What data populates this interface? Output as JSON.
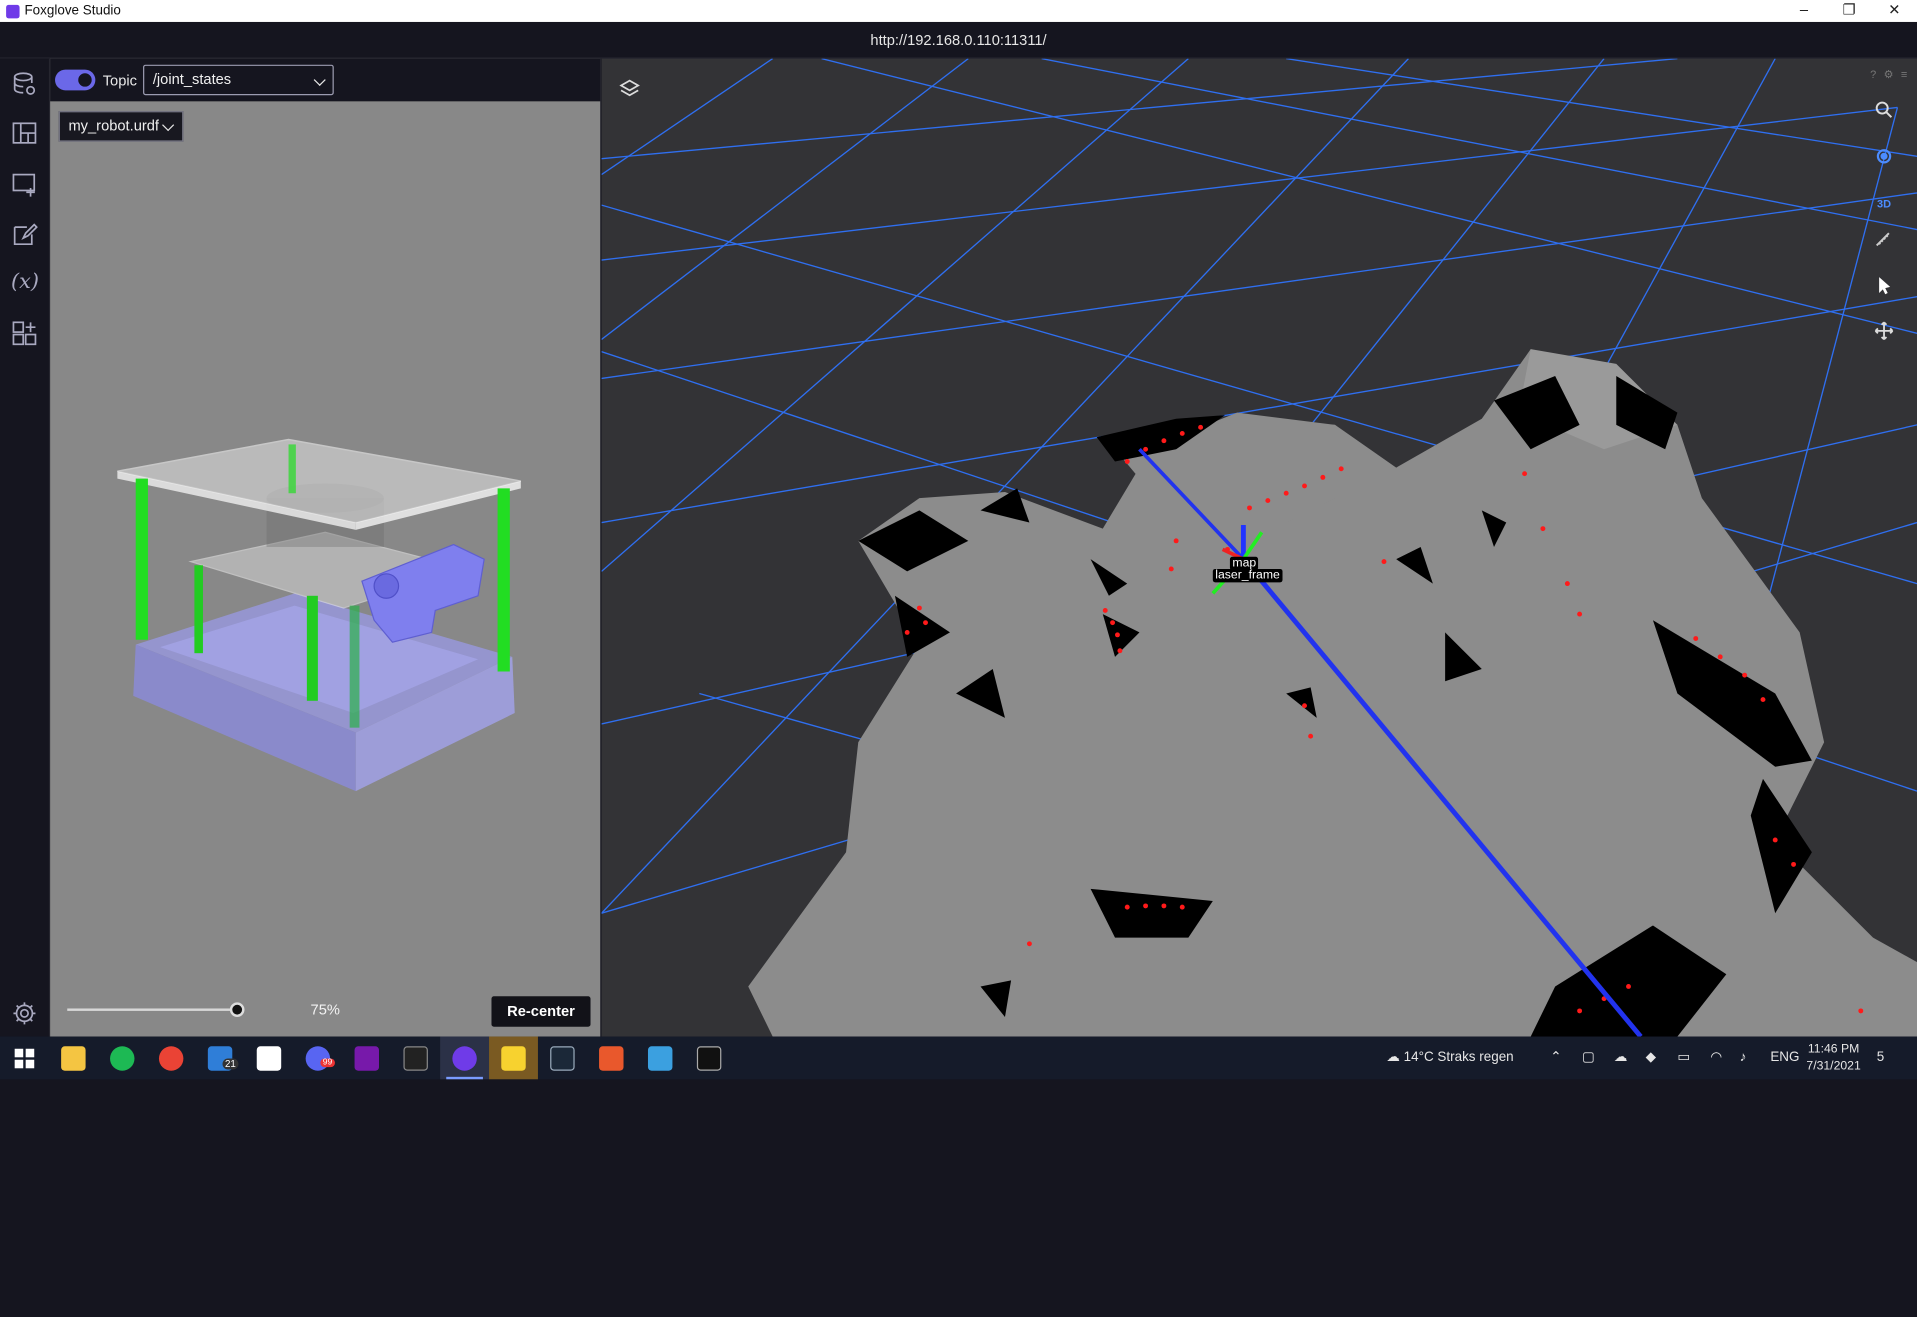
{
  "window": {
    "title": "Foxglove Studio",
    "minimize": "–",
    "restore": "❐",
    "close": "✕"
  },
  "address": "http://192.168.0.110:11311/",
  "urdf_panel": {
    "topic_label": "Topic",
    "topic_value": "/joint_states",
    "file_value": "my_robot.urdf",
    "zoom_percent": "75%",
    "zoom_fraction": 0.75,
    "recenter_label": "Re-center"
  },
  "scene": {
    "frames": [
      "map",
      "laser_frame"
    ],
    "view_mode_label": "3D"
  },
  "taskbar": {
    "mail_badge": "21",
    "discord_badge": "99",
    "weather": "14°C  Straks regen",
    "language": "ENG",
    "time": "11:46 PM",
    "date": "7/31/2021",
    "notification_count": "5"
  },
  "colors": {
    "accent": "#6b68e8",
    "grid": "#2f6ff0",
    "tf_blue": "#2233ee",
    "laser": "#ff1a1a"
  }
}
